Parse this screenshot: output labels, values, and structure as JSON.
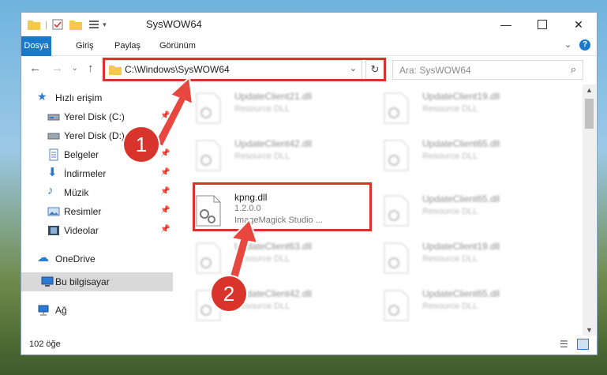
{
  "window": {
    "title": "SysWOW64"
  },
  "ribbon": {
    "tabs": [
      "Dosya",
      "Giriş",
      "Paylaş",
      "Görünüm"
    ]
  },
  "address": {
    "path": "C:\\Windows\\SysWOW64"
  },
  "search": {
    "placeholder": "Ara: SysWOW64"
  },
  "sidebar": {
    "items": [
      {
        "label": "Hızlı erişim",
        "pinned": false
      },
      {
        "label": "Yerel Disk (C:)",
        "pinned": true
      },
      {
        "label": "Yerel Disk (D:)",
        "pinned": true
      },
      {
        "label": "Belgeler",
        "pinned": true
      },
      {
        "label": "İndirmeler",
        "pinned": true
      },
      {
        "label": "Müzik",
        "pinned": true
      },
      {
        "label": "Resimler",
        "pinned": true
      },
      {
        "label": "Videolar",
        "pinned": true
      },
      {
        "label": "OneDrive",
        "pinned": false
      },
      {
        "label": "Bu bilgisayar",
        "pinned": false
      },
      {
        "label": "Ağ",
        "pinned": false
      }
    ]
  },
  "files": [
    {
      "name": "UpdateClient21.dll",
      "desc": "Resource DLL"
    },
    {
      "name": "UpdateClient19.dll",
      "desc": "Resource DLL"
    },
    {
      "name": "UpdateClient42.dll",
      "desc": "Resource DLL"
    },
    {
      "name": "UpdateClient65.dll",
      "desc": "Resource DLL"
    },
    {
      "name": "kpng.dll",
      "version": "1.2.0.0",
      "desc": "ImageMagick Studio ..."
    },
    {
      "name": "UpdateClient65.dll",
      "desc": "Resource DLL"
    },
    {
      "name": "UpdateClient63.dll",
      "desc": "Resource DLL"
    },
    {
      "name": "UpdateClient19.dll",
      "desc": "Resource DLL"
    },
    {
      "name": "UpdateClient42.dll",
      "desc": "Resource DLL"
    },
    {
      "name": "UpdateClient65.dll",
      "desc": "Resource DLL"
    }
  ],
  "status": {
    "count": "102 öğe"
  },
  "annotations": {
    "step1": "1",
    "step2": "2"
  },
  "colors": {
    "accent": "#1979ca",
    "highlight": "#d9342b"
  }
}
